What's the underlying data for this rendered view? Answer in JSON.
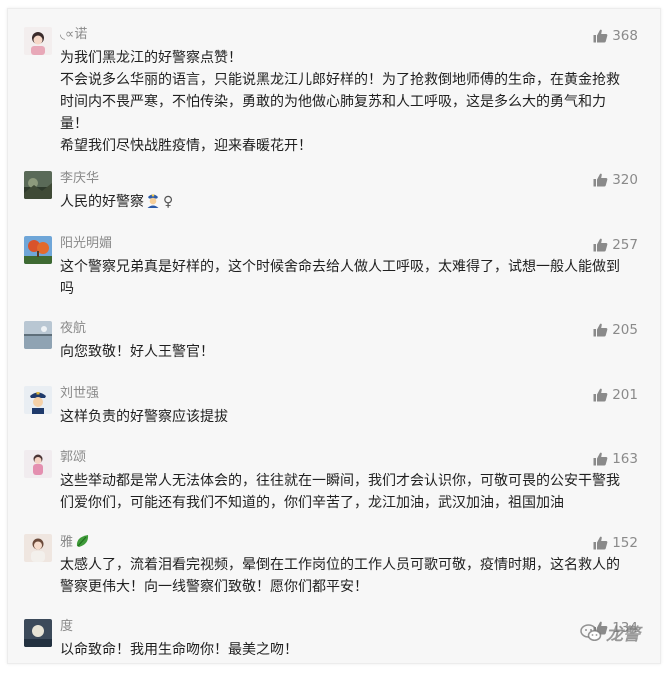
{
  "comments": [
    {
      "nickname": "◟∝诺",
      "likes": "368",
      "lines": [
        "为我们黑龙江的好警察点赞！",
        "不会说多么华丽的语言，只能说黑龙江儿郎好样的！为了抢救倒地师傅的生命，在黄金抢救时间内不畏严寒，不怕传染，勇敢的为他做心肺复苏和人工呼吸，这是多么大的勇气和力量！",
        "希望我们尽快战胜疫情，迎来春暖花开！"
      ]
    },
    {
      "nickname": "李庆华",
      "likes": "320",
      "text_before": "人民的好警察",
      "text_after": "♀",
      "emoji_icon": "police-officer-emoji-icon"
    },
    {
      "nickname": "阳光明媚",
      "likes": "257",
      "lines": [
        "这个警察兄弟真是好样的，这个时候舍命去给人做人工呼吸，太难得了，试想一般人能做到吗"
      ]
    },
    {
      "nickname": "夜航",
      "likes": "205",
      "lines": [
        "向您致敬！好人王警官！"
      ]
    },
    {
      "nickname": "刘世强",
      "likes": "201",
      "lines": [
        "这样负责的好警察应该提拔"
      ]
    },
    {
      "nickname": "郭颂",
      "likes": "163",
      "lines": [
        "这些举动都是常人无法体会的，往往就在一瞬间，我们才会认识你，可敬可畏的公安干警我们爱你们，可能还有我们不知道的，你们辛苦了，龙江加油，武汉加油，祖国加油"
      ]
    },
    {
      "nickname": "雅",
      "likes": "152",
      "lines": [
        "太感人了，流着泪看完视频，晕倒在工作岗位的工作人员可歌可敬，疫情时期，这名救人的警察更伟大！向一线警察们致敬！愿你们都平安！"
      ]
    },
    {
      "nickname": "度",
      "likes": "134",
      "lines": [
        "以命致命！我用生命吻你！最美之吻！"
      ]
    }
  ],
  "watermark": {
    "text": "龙警"
  },
  "colors": {
    "panel_background": "#f7f7f7",
    "meta_gray": "#8a8a8a",
    "body_text": "#1f1f1f"
  },
  "icons": {
    "likes": "thumbs-up-icon",
    "watermark": "wechat-icon"
  }
}
